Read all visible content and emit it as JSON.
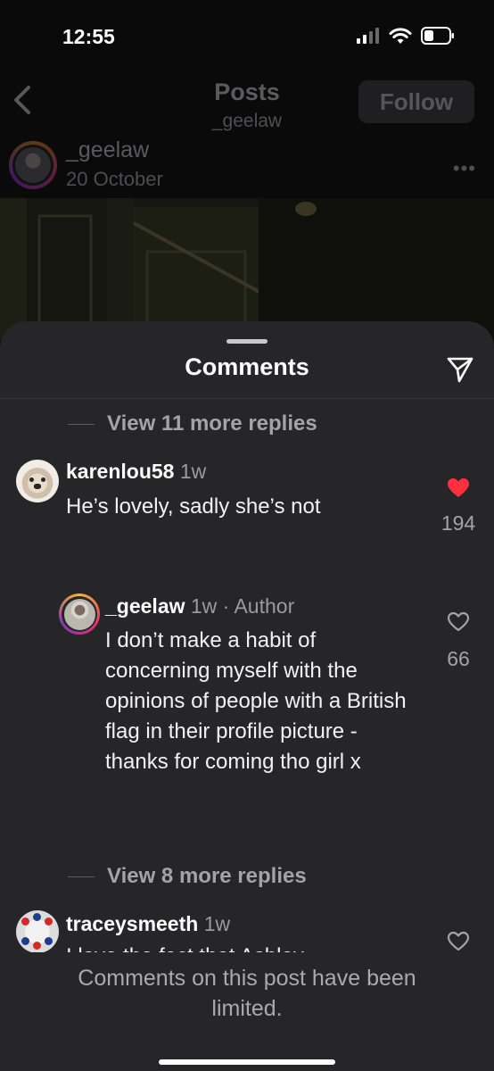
{
  "status_bar": {
    "time": "12:55"
  },
  "nav": {
    "title": "Posts",
    "subtitle": "_geelaw",
    "follow_label": "Follow"
  },
  "post": {
    "username": "_geelaw",
    "date": "20 October",
    "more": "•••"
  },
  "sheet": {
    "title": "Comments"
  },
  "comments": {
    "view_more_1": "View 11 more replies",
    "c1": {
      "username": "karenlou58",
      "time": "1w",
      "text": "He’s lovely, sadly she’s not",
      "likes": "194",
      "liked": true
    },
    "c2": {
      "username": "_geelaw",
      "meta": "1w · Author",
      "text": "I don’t make a habit of concerning myself with the opinions of people with a British flag in their profile picture - thanks for coming tho girl x",
      "likes": "66",
      "liked": false
    },
    "view_more_2": "View 8 more replies",
    "c3": {
      "username": "traceysmeeth",
      "time": "1w",
      "text": "I love the fact that Ashley",
      "liked": false
    }
  },
  "footer": {
    "limited_text": "Comments on this post have been limited."
  },
  "colors": {
    "sheet_bg": "#262629",
    "like_red": "#ff3040",
    "muted": "#a3a3a8"
  }
}
